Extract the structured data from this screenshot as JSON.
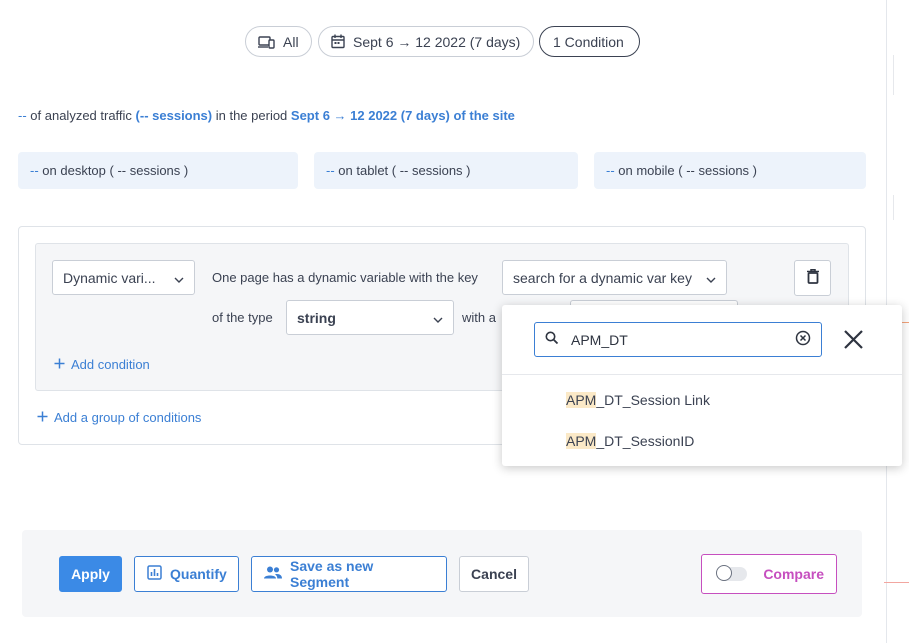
{
  "filters": {
    "device_label": "All",
    "date_label": "Sept 6 → 12 2022 (7 days)",
    "condition_label": "1 Condition"
  },
  "summary": {
    "prefix": "--",
    "text1": " of analyzed traffic ",
    "sessions": "(-- sessions)",
    "text2": " in the period ",
    "period": "Sept 6 → 12 2022 (7 days) of the site"
  },
  "devices": [
    {
      "value": "--",
      "text": " on desktop ( -- sessions )"
    },
    {
      "value": "--",
      "text": " on tablet ( -- sessions )"
    },
    {
      "value": "--",
      "text": " on mobile ( -- sessions )"
    }
  ],
  "condition": {
    "type_select": "Dynamic vari...",
    "sentence": "One page has a dynamic variable with the key",
    "key_select": "search for a dynamic var key",
    "of_type_label": "of the type",
    "type_value": "string",
    "with_label": "with a"
  },
  "links": {
    "add_condition": "Add condition",
    "add_group": "Add a group of conditions"
  },
  "dropdown": {
    "search_value": "APM_DT",
    "options": [
      {
        "match": "APM",
        "rest": "_DT_Session Link"
      },
      {
        "match": "APM",
        "rest": "_DT_SessionID"
      }
    ]
  },
  "footer": {
    "apply": "Apply",
    "quantify": "Quantify",
    "save_segment": "Save as new Segment",
    "cancel": "Cancel",
    "compare": "Compare"
  },
  "colors": {
    "accent": "#3b7fd4",
    "primary_button": "#3b8ae6",
    "compare": "#c64fbf"
  },
  "icons": [
    "devices-icon",
    "calendar-icon",
    "chevron-down-icon",
    "trash-icon",
    "plus-icon",
    "search-icon",
    "clear-circle-icon",
    "close-icon",
    "chart-icon",
    "users-icon",
    "toggle-switch"
  ]
}
